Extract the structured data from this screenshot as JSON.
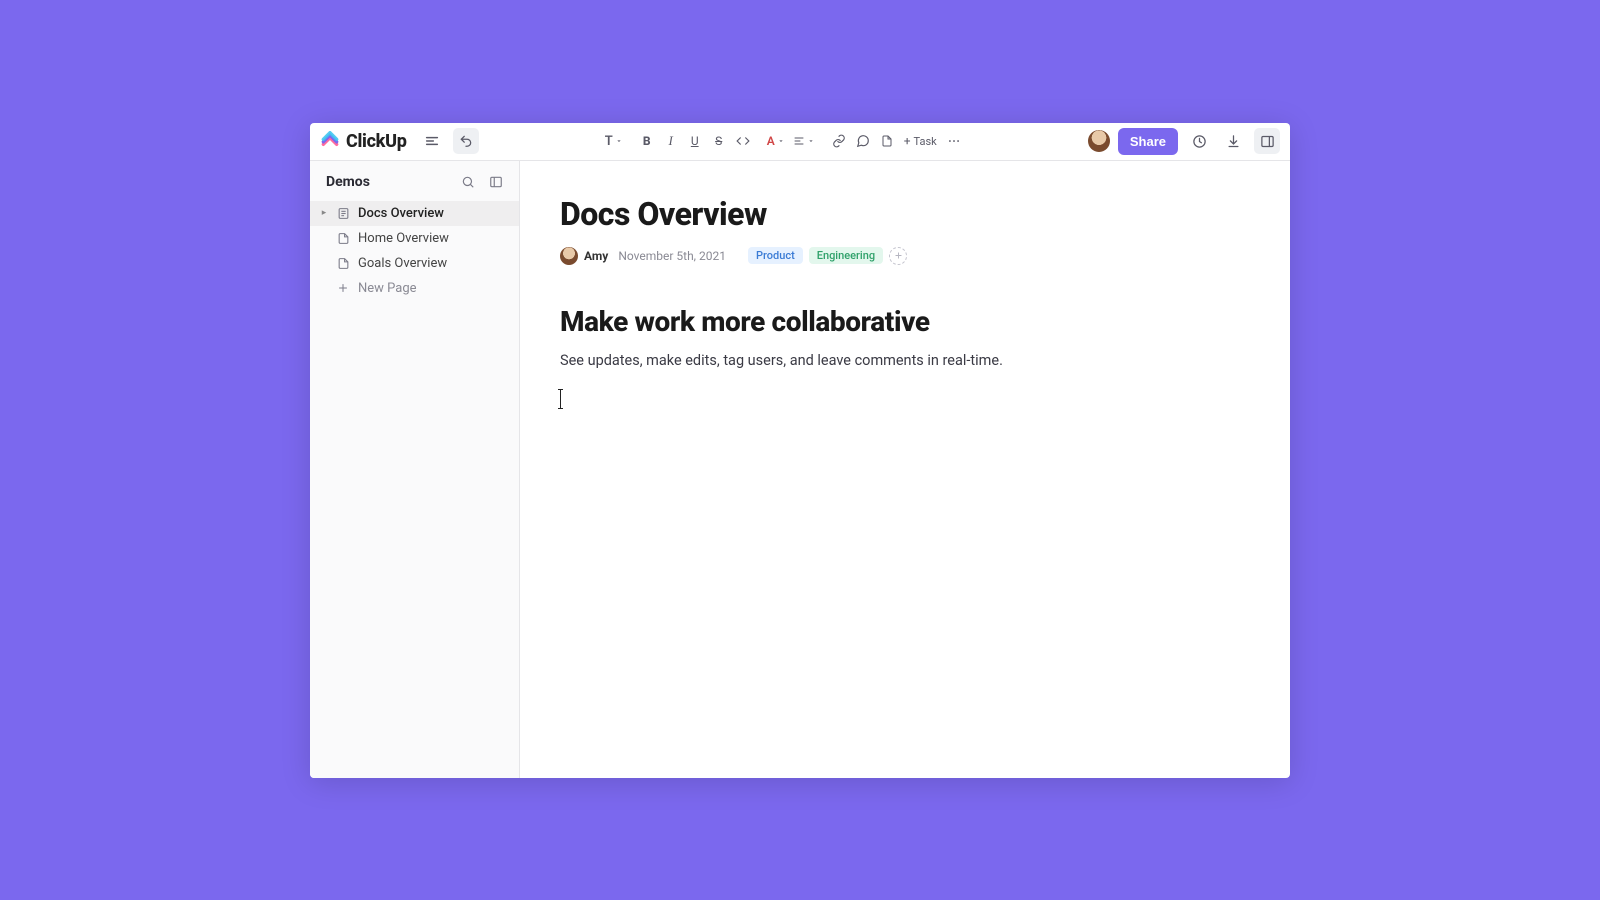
{
  "brand": {
    "name": "ClickUp"
  },
  "topbar": {
    "share_label": "Share",
    "task_label": "Task"
  },
  "sidebar": {
    "space_name": "Demos",
    "items": [
      {
        "label": "Docs Overview",
        "selected": true
      },
      {
        "label": "Home Overview",
        "selected": false
      },
      {
        "label": "Goals Overview",
        "selected": false
      }
    ],
    "new_page_label": "New Page"
  },
  "doc": {
    "title": "Docs Overview",
    "author": "Amy",
    "date": "November 5th, 2021",
    "tags": [
      {
        "label": "Product",
        "kind": "product"
      },
      {
        "label": "Engineering",
        "kind": "eng"
      }
    ],
    "heading": "Make work more collaborative",
    "paragraph": "See updates, make edits, tag users, and leave comments in real-time."
  }
}
